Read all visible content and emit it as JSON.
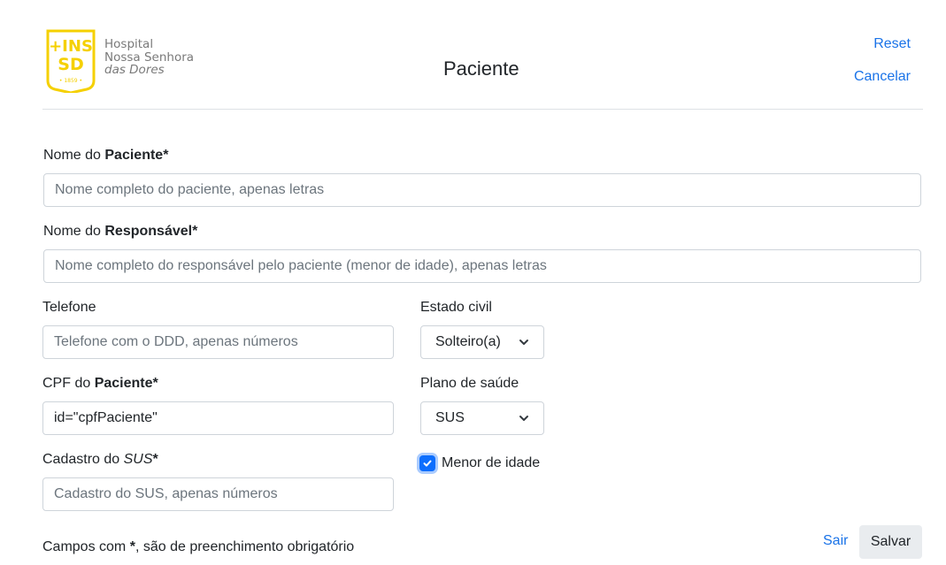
{
  "header": {
    "logo": {
      "monogram_top": "+INS",
      "monogram_bottom": "SD",
      "year": "• 1859 •",
      "line1": "Hospital",
      "line2": "Nossa Senhora",
      "line3": "das Dores"
    },
    "title": "Paciente",
    "reset_label": "Reset",
    "cancel_label": "Cancelar"
  },
  "form": {
    "nome_paciente": {
      "label_prefix": "Nome do ",
      "label_bold": "Paciente*",
      "placeholder": "Nome completo do paciente, apenas letras"
    },
    "nome_responsavel": {
      "label_prefix": "Nome do ",
      "label_bold": "Responsável*",
      "placeholder": "Nome completo do responsável pelo paciente (menor de idade), apenas letras"
    },
    "telefone": {
      "label": "Telefone",
      "placeholder": "Telefone com o DDD, apenas números"
    },
    "estado_civil": {
      "label": "Estado civil",
      "value": "Solteiro(a)"
    },
    "cpf": {
      "label_prefix": "CPF do ",
      "label_bold": "Paciente*",
      "value": "id=\"cpfPaciente\""
    },
    "plano_saude": {
      "label": "Plano de saúde",
      "value": "SUS"
    },
    "cadastro_sus": {
      "label_prefix": "Cadastro do ",
      "label_italic": "SUS",
      "label_suffix": "*",
      "placeholder": "Cadastro do SUS, apenas números"
    },
    "menor_idade": {
      "label": "Menor de idade",
      "checked": true
    }
  },
  "footer": {
    "note_prefix": "Campos com ",
    "note_bold": "*",
    "note_suffix": ", são de preenchimento obrigatório",
    "sair_label": "Sair",
    "salvar_label": "Salvar"
  },
  "colors": {
    "logo_yellow": "#f5d000",
    "link_blue": "#1a73e8",
    "checkbox_blue": "#0d6efd"
  }
}
